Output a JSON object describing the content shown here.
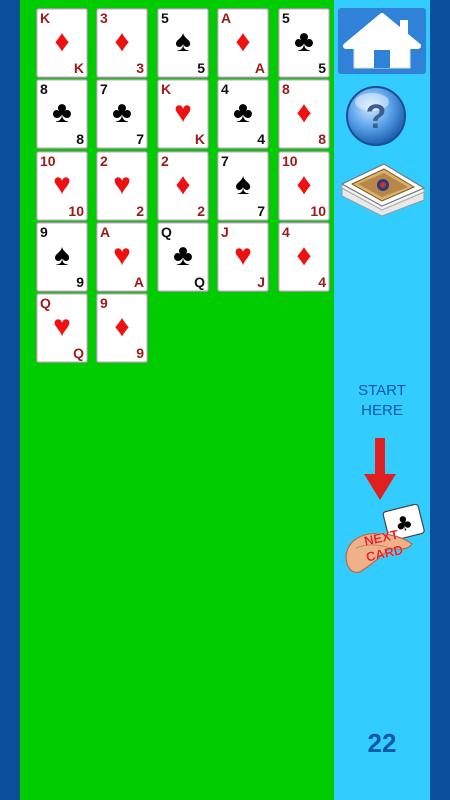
{
  "tableau": {
    "rows": [
      [
        {
          "rank": "K",
          "suit": "diamond"
        },
        {
          "rank": "3",
          "suit": "diamond"
        },
        {
          "rank": "5",
          "suit": "spade"
        },
        {
          "rank": "A",
          "suit": "diamond"
        },
        {
          "rank": "5",
          "suit": "club"
        }
      ],
      [
        {
          "rank": "8",
          "suit": "club"
        },
        {
          "rank": "7",
          "suit": "club"
        },
        {
          "rank": "K",
          "suit": "heart"
        },
        {
          "rank": "4",
          "suit": "club"
        },
        {
          "rank": "8",
          "suit": "diamond"
        }
      ],
      [
        {
          "rank": "10",
          "suit": "heart"
        },
        {
          "rank": "2",
          "suit": "heart"
        },
        {
          "rank": "2",
          "suit": "diamond"
        },
        {
          "rank": "7",
          "suit": "spade"
        },
        {
          "rank": "10",
          "suit": "diamond"
        }
      ],
      [
        {
          "rank": "9",
          "suit": "spade"
        },
        {
          "rank": "A",
          "suit": "heart"
        },
        {
          "rank": "Q",
          "suit": "club"
        },
        {
          "rank": "J",
          "suit": "heart"
        },
        {
          "rank": "4",
          "suit": "diamond"
        }
      ],
      [
        {
          "rank": "Q",
          "suit": "heart"
        },
        {
          "rank": "9",
          "suit": "diamond"
        }
      ]
    ]
  },
  "sidebar": {
    "home_icon": "home-icon",
    "help_icon": "question-mark-icon",
    "deck_icon": "card-deck-icon",
    "start_text_line1": "START",
    "start_text_line2": "HERE",
    "arrow_icon": "down-arrow-icon",
    "next_card_line1": "NEXT",
    "next_card_line2": "CARD",
    "remaining_count": "22"
  },
  "colors": {
    "felt": "#00cc00",
    "sidebar": "#33ccff",
    "frame": "#0a4f9a",
    "red_suit": "#ee1111",
    "text_blue": "#0c58a8"
  }
}
